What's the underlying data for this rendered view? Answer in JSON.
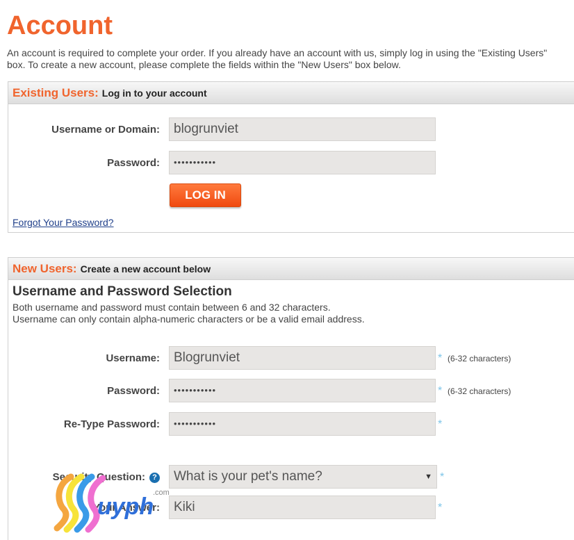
{
  "header": {
    "title": "Account",
    "intro": "An account is required to complete your order. If you already have an account with us, simply log in using the \"Existing Users\" box. To create a new account, please complete the fields within the \"New Users\" box below."
  },
  "existing": {
    "accent": "Existing Users:",
    "subtitle": "Log in to your account",
    "username_label": "Username or Domain:",
    "username_value": "blogrunviet",
    "password_label": "Password:",
    "password_value": "•••••••••••",
    "login_button": "LOG IN",
    "forgot_link": "Forgot Your Password?"
  },
  "new_users": {
    "accent": "New Users:",
    "subtitle": "Create a new account below",
    "section_title": "Username and Password Selection",
    "desc_line1": "Both username and password must contain between 6 and 32 characters.",
    "desc_line2": "Username can only contain alpha-numeric characters or be a valid email address.",
    "username_label": "Username:",
    "username_value": "Blogrunviet",
    "username_hint": "(6-32 characters)",
    "password_label": "Password:",
    "password_value": "•••••••••••",
    "password_hint": "(6-32 characters)",
    "retype_label": "Re-Type Password:",
    "retype_value": "•••••••••••",
    "security_label": "Security Question:",
    "security_value": "What is your pet's name?",
    "answer_label": "Your Answer:",
    "answer_value": "Kiki",
    "required_mark": "*"
  },
  "icons": {
    "help": "question-circle-icon",
    "select_arrow": "chevron-down-icon",
    "watermark_text": "uyph",
    "watermark_domain": ".com"
  },
  "colors": {
    "accent": "#f0642d",
    "link": "#1f3f8a",
    "required": "#7ec5e8",
    "field_bg": "#e8e6e4"
  }
}
